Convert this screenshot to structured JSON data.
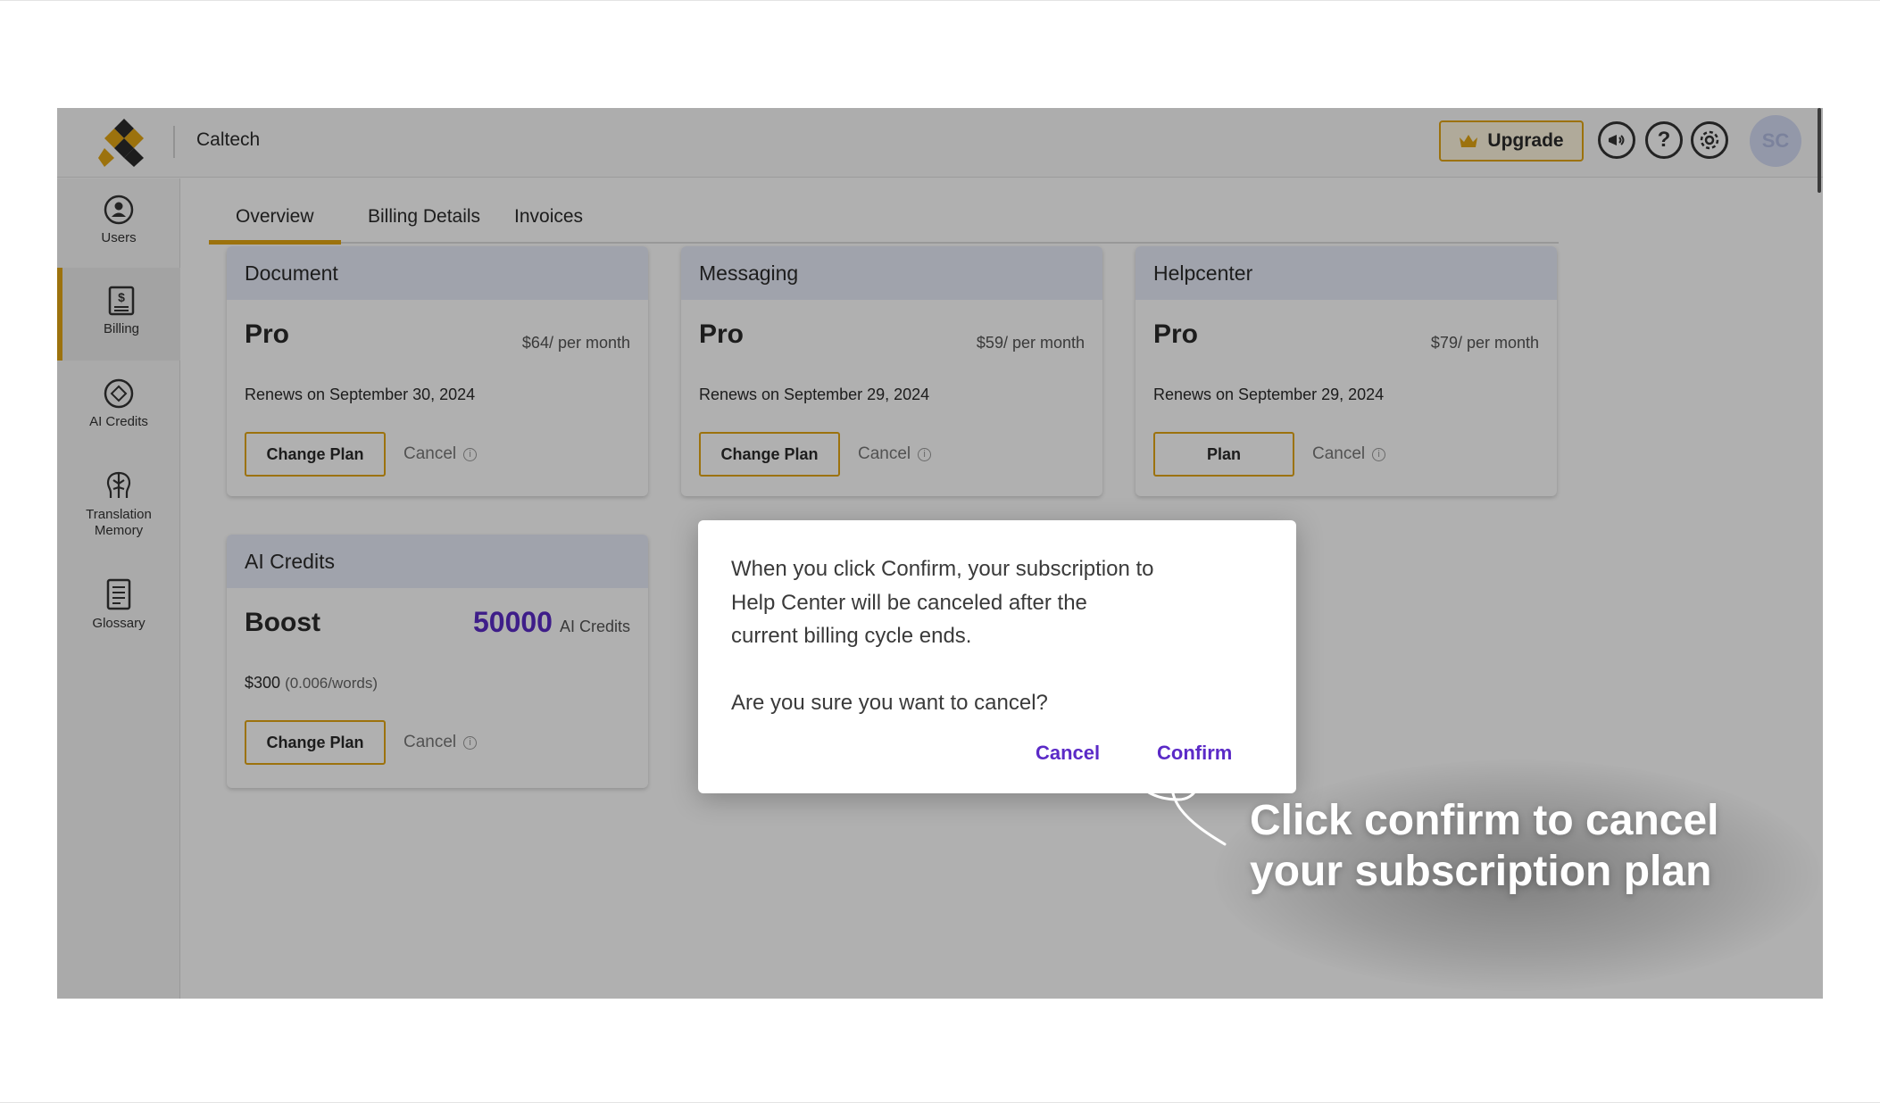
{
  "header": {
    "org_name": "Caltech",
    "upgrade_label": "Upgrade",
    "avatar_initials": "SC",
    "icons": [
      "crown-icon",
      "megaphone-icon",
      "help-icon",
      "settings-icon"
    ]
  },
  "sidebar": {
    "items": [
      {
        "label": "Users",
        "icon": "user-icon"
      },
      {
        "label": "Billing",
        "icon": "billing-icon",
        "active": true
      },
      {
        "label": "AI Credits",
        "icon": "ai-credits-icon"
      },
      {
        "label": "Translation Memory",
        "icon": "translation-memory-icon"
      },
      {
        "label": "Glossary",
        "icon": "glossary-icon"
      }
    ]
  },
  "tabs": [
    {
      "label": "Overview",
      "active": true
    },
    {
      "label": "Billing Details"
    },
    {
      "label": "Invoices"
    }
  ],
  "cards": [
    {
      "title": "Document",
      "plan": "Pro",
      "price": "$64/ per month",
      "renew": "Renews on September 30, 2024",
      "change_label": "Change Plan",
      "cancel_label": "Cancel"
    },
    {
      "title": "Messaging",
      "plan": "Pro",
      "price": "$59/ per month",
      "renew": "Renews on September 29, 2024",
      "change_label": "Change Plan",
      "cancel_label": "Cancel"
    },
    {
      "title": "Helpcenter",
      "plan": "Pro",
      "price": "$79/ per month",
      "renew": "Renews on September 29, 2024",
      "change_label": "Plan",
      "cancel_label": "Cancel"
    }
  ],
  "credits_card": {
    "title": "AI Credits",
    "plan": "Boost",
    "amount": "50000",
    "unit": "AI Credits",
    "price": "$300",
    "rate": "(0.006/words)",
    "change_label": "Change Plan",
    "cancel_label": "Cancel"
  },
  "dialog": {
    "message": "When you click Confirm, your subscription to Help Center will be canceled after the current billing cycle ends.",
    "question": "Are you sure you want to cancel?",
    "cancel_label": "Cancel",
    "confirm_label": "Confirm"
  },
  "annotation": {
    "callout_line1": "Click confirm to cancel",
    "callout_line2": "your subscription plan"
  },
  "colors": {
    "accent_gold": "#e2a514",
    "accent_purple": "#5b2ac7",
    "card_header": "#e8ecf9"
  }
}
